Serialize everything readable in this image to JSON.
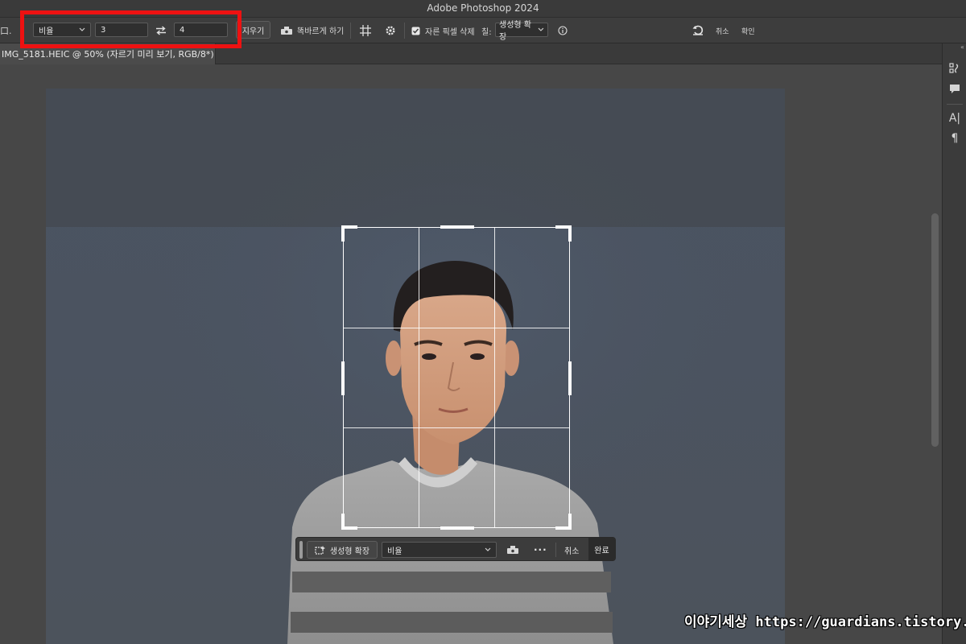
{
  "window": {
    "title": "Adobe Photoshop 2024"
  },
  "options_bar": {
    "tool_glyph": "口.",
    "ratio_select": "비율",
    "ratio_width": "3",
    "ratio_height": "4",
    "clear_button": "지우기",
    "straighten_label": "똑바르게 하기",
    "delete_cropped_label": "자른 픽셀 삭제",
    "delete_cropped_checked": true,
    "fill_label": "칠:",
    "fill_select": "생성형 확장",
    "cancel_label": "취소",
    "confirm_label": "확인"
  },
  "document_tab": {
    "title": "IMG_5181.HEIC @ 50% (자르기 미리 보기, RGB/8*) *"
  },
  "crop_toolbar": {
    "generative_expand_button": "생성형 확장",
    "ratio_select": "비율",
    "more_label": "···",
    "cancel_button": "취소",
    "done_button": "완료"
  },
  "watermark": {
    "text": "이야기세상 https://guardians.tistory.com"
  },
  "colors": {
    "highlight": "#ee1111",
    "canvas": "#474747",
    "photo_background": "#4a5462"
  },
  "icons": [
    "crop-tool-icon",
    "dropdown-chevron-icon",
    "swap-arrows-icon",
    "straighten-level-icon",
    "grid-overlay-icon",
    "gear-icon",
    "checkbox-icon",
    "info-icon",
    "reset-icon",
    "properties-icon",
    "comment-icon",
    "character-icon",
    "paragraph-icon",
    "generative-expand-icon"
  ]
}
